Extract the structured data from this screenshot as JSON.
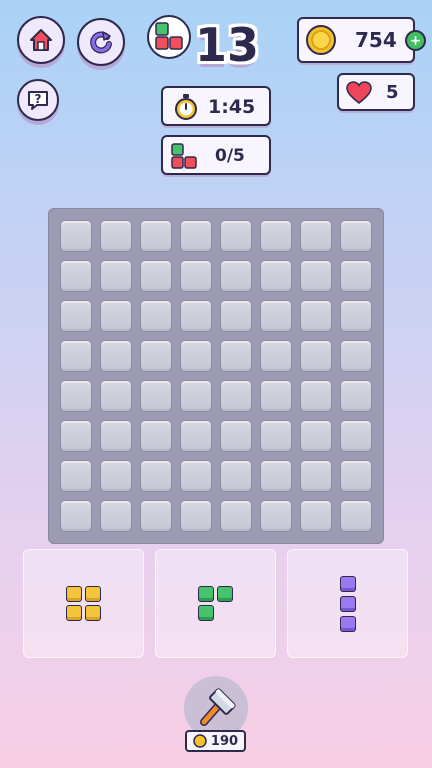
{
  "header": {
    "level": "13",
    "coins": "754",
    "lives": "5",
    "timer": "1:45",
    "goal_progress": "0/5"
  },
  "icons": {
    "home": "home-icon",
    "restart": "restart-icon",
    "help": "help-icon",
    "coin": "coin-icon",
    "heart": "heart-icon",
    "stopwatch": "stopwatch-icon",
    "blocks": "blocks-icon",
    "add": "plus-icon",
    "hammer": "hammer-icon"
  },
  "board": {
    "rows": 8,
    "cols": 8
  },
  "pieces": [
    {
      "shape": "square-2x2",
      "color": "#f2c53d"
    },
    {
      "shape": "corner-3",
      "color": "#47c36e"
    },
    {
      "shape": "vertical-3",
      "color": "#9a7bef"
    }
  ],
  "booster": {
    "cost": "190"
  },
  "colors": {
    "outline": "#2e2a4e",
    "heart": "#f0445a",
    "coin": "#f5c22b",
    "add": "#3fbf5f"
  }
}
